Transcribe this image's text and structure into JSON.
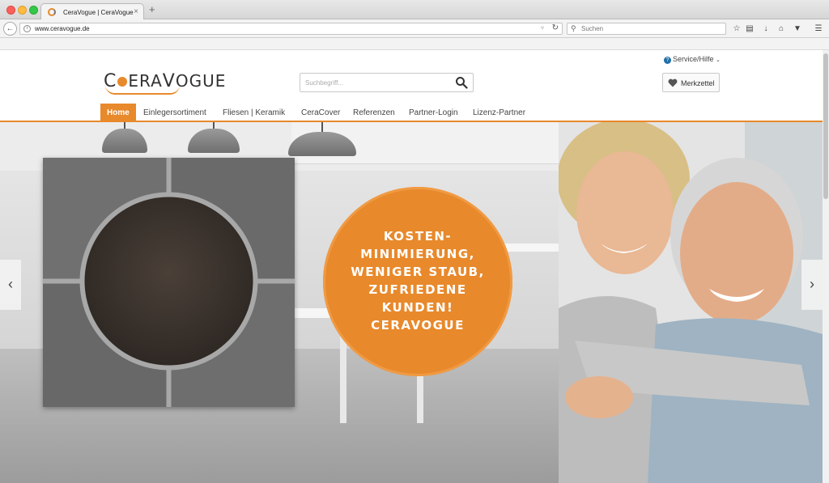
{
  "browser": {
    "tab_title": "CeraVogue | CeraVogue",
    "tab_close": "×",
    "new_tab": "+",
    "url": "www.ceravogue.de",
    "search_placeholder": "Suchen"
  },
  "header": {
    "service_label": "Service/Hilfe",
    "logo_text_a": "C",
    "logo_text_b": "ERA",
    "logo_text_c": "V",
    "logo_text_d": "OGUE",
    "search_placeholder": "Suchbegriff...",
    "merkzettel_label": "Merkzettel"
  },
  "nav": {
    "items": [
      {
        "label": "Home"
      },
      {
        "label": "Einlegersortiment"
      },
      {
        "label": "Fliesen | Keramik"
      },
      {
        "label": "CeraCover"
      },
      {
        "label": "Referenzen"
      },
      {
        "label": "Partner-Login"
      },
      {
        "label": "Lizenz-Partner"
      }
    ]
  },
  "hero": {
    "badge_lines": [
      "KOSTEN-",
      "MINIMIERUNG,",
      "WENIGER STAUB,",
      "ZUFRIEDENE",
      "KUNDEN!",
      "CERAVOGUE"
    ],
    "prev_arrow": "‹",
    "next_arrow": "›"
  },
  "colors": {
    "accent": "#e8892b",
    "nav_text": "#444444",
    "service_icon": "#1e6fa8"
  },
  "icons": {
    "back": "back-arrow-icon",
    "info": "info-icon",
    "reload": "reload-icon",
    "search": "search-icon",
    "bookmark_star": "star-icon",
    "reading_list": "clipboard-icon",
    "download": "download-icon",
    "home": "home-icon",
    "pocket": "pocket-icon",
    "menu": "hamburger-menu-icon",
    "merkzettel": "heart-icon",
    "service": "question-icon"
  }
}
